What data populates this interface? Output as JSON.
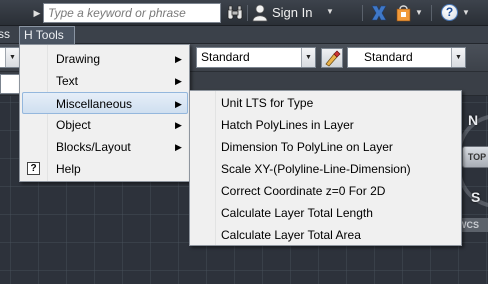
{
  "titlebar": {
    "search_placeholder": "Type a keyword or phrase",
    "sign_in": "Sign In",
    "help_glyph": "?"
  },
  "menubar": {
    "items": [
      {
        "label": "ss"
      },
      {
        "label": "H Tools"
      }
    ]
  },
  "toolbar": {
    "style_combo_1": "Standard",
    "style_combo_2": "Standard"
  },
  "menu": {
    "items": [
      {
        "label": "Drawing",
        "has_submenu": true
      },
      {
        "label": "Text",
        "has_submenu": true
      },
      {
        "label": "Miscellaneous",
        "has_submenu": true,
        "highlighted": true
      },
      {
        "label": "Object",
        "has_submenu": true
      },
      {
        "label": "Blocks/Layout",
        "has_submenu": true
      },
      {
        "label": "Help",
        "has_submenu": false,
        "icon": "help-icon"
      }
    ]
  },
  "submenu": {
    "parent": "Miscellaneous",
    "items": [
      {
        "label": "Unit LTS for Type"
      },
      {
        "label": "Hatch PolyLines in Layer"
      },
      {
        "label": "Dimension To PolyLine on Layer"
      },
      {
        "label": "Scale XY-(Polyline-Line-Dimension)"
      },
      {
        "label": "Correct Coordinate z=0 For 2D"
      },
      {
        "label": "Calculate Layer Total Length"
      },
      {
        "label": "Calculate Layer Total Area"
      }
    ]
  },
  "viewcube": {
    "north": "N",
    "top": "TOP",
    "south": "S",
    "wcs": "WCS"
  },
  "colors": {
    "canvas": "#2d323b",
    "menu_bg": "#f0f0f0",
    "highlight": "#cfdff0",
    "highlight_border": "#94b7dd"
  }
}
